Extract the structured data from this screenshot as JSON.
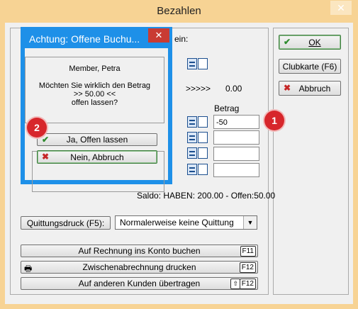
{
  "window": {
    "title": "Bezahlen",
    "close_glyph": "✕"
  },
  "background_label_partial": "ein:",
  "right_buttons": {
    "ok": "OK",
    "clubkarte": "Clubkarte (F6)",
    "abbruch": "Abbruch"
  },
  "arrows_text": ">>>>>",
  "arrows_value": "0.00",
  "betrag_header": "Betrag",
  "betrag_value": "-50",
  "saldo": "Saldo: HABEN: 200.00 - Offen:50.00",
  "quittung": {
    "button": "Quittungsdruck (F5):",
    "selected": "Normalerweise keine Quittung"
  },
  "bottom_buttons": {
    "rechnung": "Auf Rechnung ins Konto buchen",
    "rechnung_key": "F11",
    "zwischen": "Zwischenabrechnung drucken",
    "zwischen_key": "F12",
    "uebertragen": "Auf anderen Kunden übertragen",
    "uebertragen_key": "F12"
  },
  "dialog": {
    "title": "Achtung: Offene Buchu...",
    "member": "Member, Petra",
    "question_line1": "Möchten Sie wirklich den Betrag",
    "question_line2": ">> 50.00 <<",
    "question_line3": "offen lassen?",
    "yes": "Ja, Offen lassen",
    "no": "Nein, Abbruch"
  },
  "badges": {
    "one": "1",
    "two": "2"
  },
  "colors": {
    "accent_blue": "#1e90e8",
    "badge_red": "#d7262b",
    "window_frame": "#f7d394"
  }
}
